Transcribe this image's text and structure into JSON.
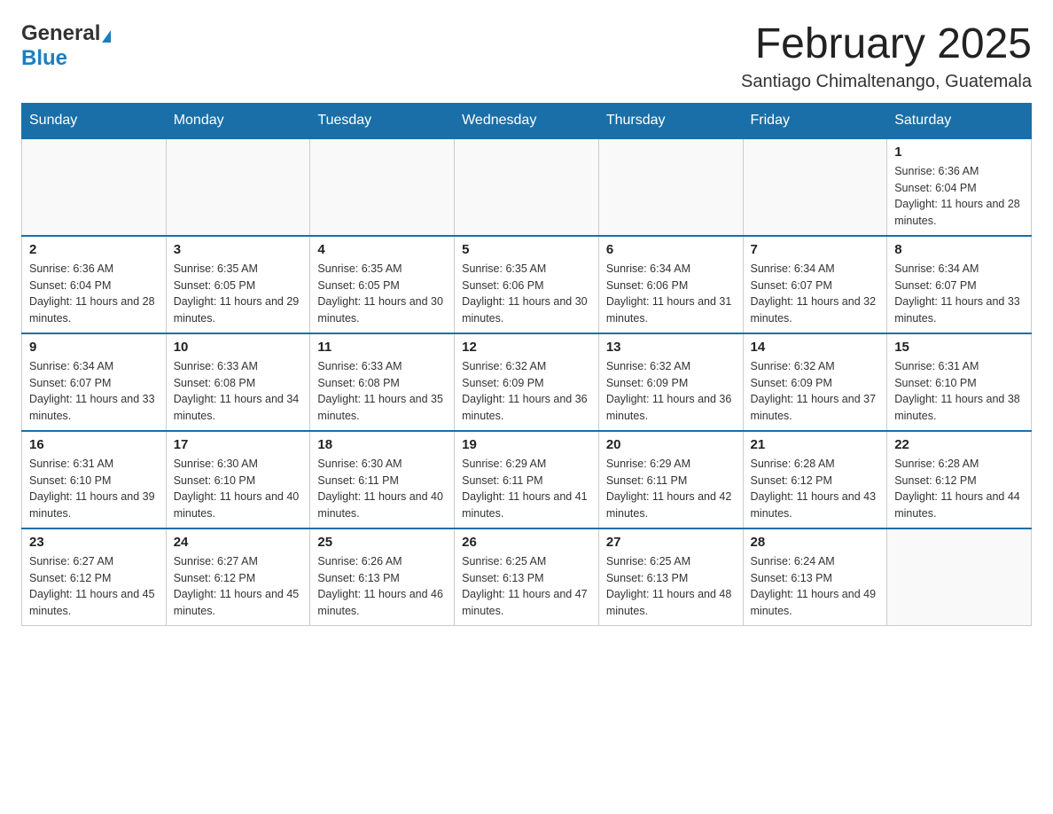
{
  "logo": {
    "text_general": "General",
    "text_blue": "Blue"
  },
  "header": {
    "month_year": "February 2025",
    "location": "Santiago Chimaltenango, Guatemala"
  },
  "days_of_week": [
    "Sunday",
    "Monday",
    "Tuesday",
    "Wednesday",
    "Thursday",
    "Friday",
    "Saturday"
  ],
  "weeks": [
    [
      {
        "day": "",
        "sunrise": "",
        "sunset": "",
        "daylight": ""
      },
      {
        "day": "",
        "sunrise": "",
        "sunset": "",
        "daylight": ""
      },
      {
        "day": "",
        "sunrise": "",
        "sunset": "",
        "daylight": ""
      },
      {
        "day": "",
        "sunrise": "",
        "sunset": "",
        "daylight": ""
      },
      {
        "day": "",
        "sunrise": "",
        "sunset": "",
        "daylight": ""
      },
      {
        "day": "",
        "sunrise": "",
        "sunset": "",
        "daylight": ""
      },
      {
        "day": "1",
        "sunrise": "Sunrise: 6:36 AM",
        "sunset": "Sunset: 6:04 PM",
        "daylight": "Daylight: 11 hours and 28 minutes."
      }
    ],
    [
      {
        "day": "2",
        "sunrise": "Sunrise: 6:36 AM",
        "sunset": "Sunset: 6:04 PM",
        "daylight": "Daylight: 11 hours and 28 minutes."
      },
      {
        "day": "3",
        "sunrise": "Sunrise: 6:35 AM",
        "sunset": "Sunset: 6:05 PM",
        "daylight": "Daylight: 11 hours and 29 minutes."
      },
      {
        "day": "4",
        "sunrise": "Sunrise: 6:35 AM",
        "sunset": "Sunset: 6:05 PM",
        "daylight": "Daylight: 11 hours and 30 minutes."
      },
      {
        "day": "5",
        "sunrise": "Sunrise: 6:35 AM",
        "sunset": "Sunset: 6:06 PM",
        "daylight": "Daylight: 11 hours and 30 minutes."
      },
      {
        "day": "6",
        "sunrise": "Sunrise: 6:34 AM",
        "sunset": "Sunset: 6:06 PM",
        "daylight": "Daylight: 11 hours and 31 minutes."
      },
      {
        "day": "7",
        "sunrise": "Sunrise: 6:34 AM",
        "sunset": "Sunset: 6:07 PM",
        "daylight": "Daylight: 11 hours and 32 minutes."
      },
      {
        "day": "8",
        "sunrise": "Sunrise: 6:34 AM",
        "sunset": "Sunset: 6:07 PM",
        "daylight": "Daylight: 11 hours and 33 minutes."
      }
    ],
    [
      {
        "day": "9",
        "sunrise": "Sunrise: 6:34 AM",
        "sunset": "Sunset: 6:07 PM",
        "daylight": "Daylight: 11 hours and 33 minutes."
      },
      {
        "day": "10",
        "sunrise": "Sunrise: 6:33 AM",
        "sunset": "Sunset: 6:08 PM",
        "daylight": "Daylight: 11 hours and 34 minutes."
      },
      {
        "day": "11",
        "sunrise": "Sunrise: 6:33 AM",
        "sunset": "Sunset: 6:08 PM",
        "daylight": "Daylight: 11 hours and 35 minutes."
      },
      {
        "day": "12",
        "sunrise": "Sunrise: 6:32 AM",
        "sunset": "Sunset: 6:09 PM",
        "daylight": "Daylight: 11 hours and 36 minutes."
      },
      {
        "day": "13",
        "sunrise": "Sunrise: 6:32 AM",
        "sunset": "Sunset: 6:09 PM",
        "daylight": "Daylight: 11 hours and 36 minutes."
      },
      {
        "day": "14",
        "sunrise": "Sunrise: 6:32 AM",
        "sunset": "Sunset: 6:09 PM",
        "daylight": "Daylight: 11 hours and 37 minutes."
      },
      {
        "day": "15",
        "sunrise": "Sunrise: 6:31 AM",
        "sunset": "Sunset: 6:10 PM",
        "daylight": "Daylight: 11 hours and 38 minutes."
      }
    ],
    [
      {
        "day": "16",
        "sunrise": "Sunrise: 6:31 AM",
        "sunset": "Sunset: 6:10 PM",
        "daylight": "Daylight: 11 hours and 39 minutes."
      },
      {
        "day": "17",
        "sunrise": "Sunrise: 6:30 AM",
        "sunset": "Sunset: 6:10 PM",
        "daylight": "Daylight: 11 hours and 40 minutes."
      },
      {
        "day": "18",
        "sunrise": "Sunrise: 6:30 AM",
        "sunset": "Sunset: 6:11 PM",
        "daylight": "Daylight: 11 hours and 40 minutes."
      },
      {
        "day": "19",
        "sunrise": "Sunrise: 6:29 AM",
        "sunset": "Sunset: 6:11 PM",
        "daylight": "Daylight: 11 hours and 41 minutes."
      },
      {
        "day": "20",
        "sunrise": "Sunrise: 6:29 AM",
        "sunset": "Sunset: 6:11 PM",
        "daylight": "Daylight: 11 hours and 42 minutes."
      },
      {
        "day": "21",
        "sunrise": "Sunrise: 6:28 AM",
        "sunset": "Sunset: 6:12 PM",
        "daylight": "Daylight: 11 hours and 43 minutes."
      },
      {
        "day": "22",
        "sunrise": "Sunrise: 6:28 AM",
        "sunset": "Sunset: 6:12 PM",
        "daylight": "Daylight: 11 hours and 44 minutes."
      }
    ],
    [
      {
        "day": "23",
        "sunrise": "Sunrise: 6:27 AM",
        "sunset": "Sunset: 6:12 PM",
        "daylight": "Daylight: 11 hours and 45 minutes."
      },
      {
        "day": "24",
        "sunrise": "Sunrise: 6:27 AM",
        "sunset": "Sunset: 6:12 PM",
        "daylight": "Daylight: 11 hours and 45 minutes."
      },
      {
        "day": "25",
        "sunrise": "Sunrise: 6:26 AM",
        "sunset": "Sunset: 6:13 PM",
        "daylight": "Daylight: 11 hours and 46 minutes."
      },
      {
        "day": "26",
        "sunrise": "Sunrise: 6:25 AM",
        "sunset": "Sunset: 6:13 PM",
        "daylight": "Daylight: 11 hours and 47 minutes."
      },
      {
        "day": "27",
        "sunrise": "Sunrise: 6:25 AM",
        "sunset": "Sunset: 6:13 PM",
        "daylight": "Daylight: 11 hours and 48 minutes."
      },
      {
        "day": "28",
        "sunrise": "Sunrise: 6:24 AM",
        "sunset": "Sunset: 6:13 PM",
        "daylight": "Daylight: 11 hours and 49 minutes."
      },
      {
        "day": "",
        "sunrise": "",
        "sunset": "",
        "daylight": ""
      }
    ]
  ]
}
